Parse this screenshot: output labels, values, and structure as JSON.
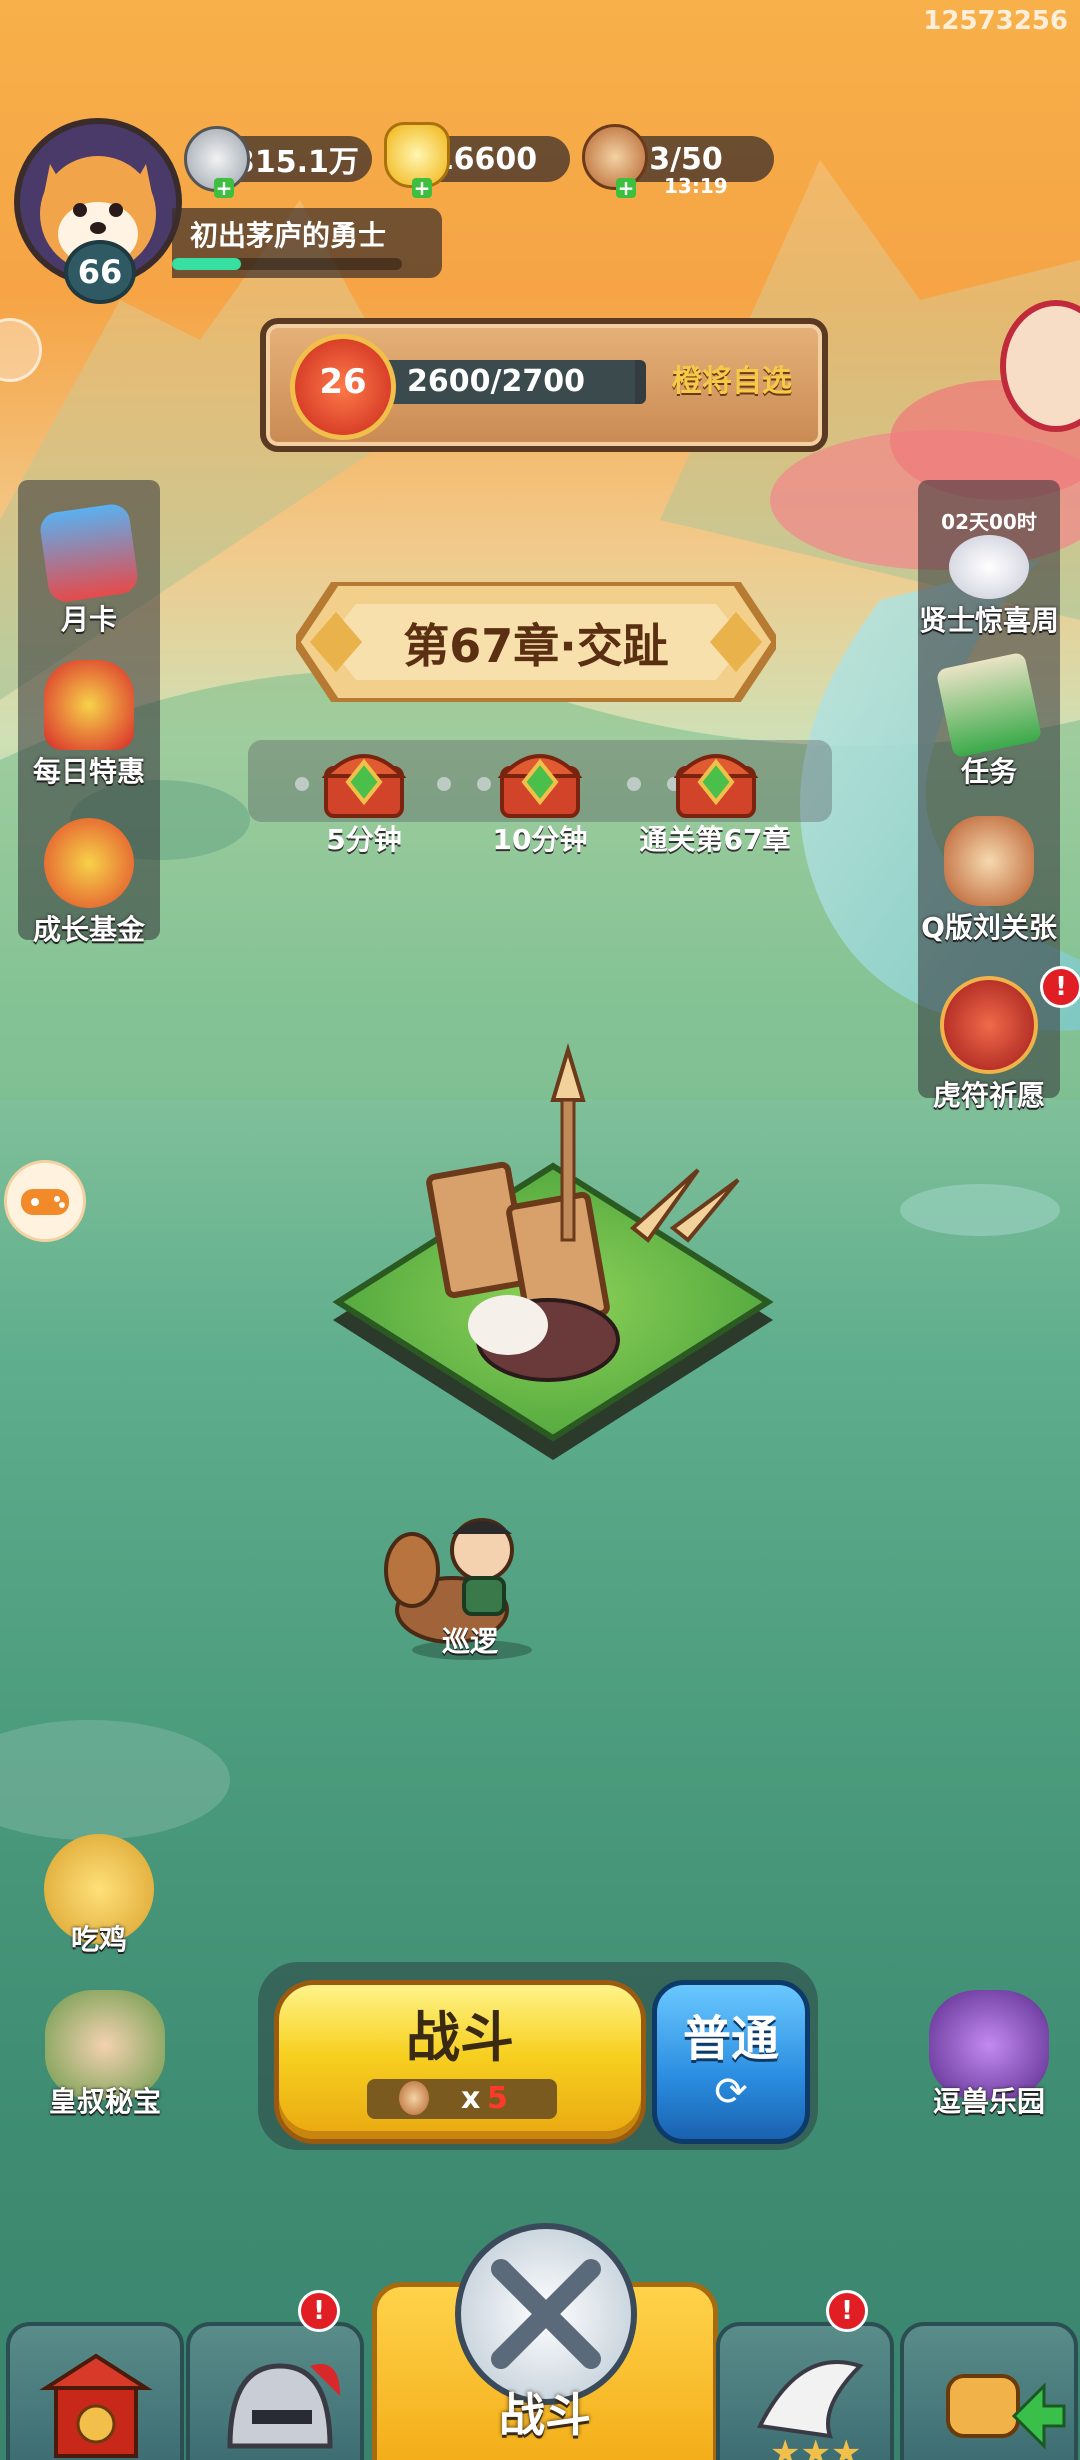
{
  "app_id": "12573256",
  "player": {
    "level": "66",
    "title": "初出茅庐的勇士",
    "exp_fraction": 0.3
  },
  "resources": {
    "silver": "2315.1万",
    "gold": "16600",
    "stamina": "3/50",
    "stamina_timer": "13:19"
  },
  "rank_bar": {
    "level": "26",
    "progress_text": "2600/2700",
    "progress_fraction": 0.963,
    "action_label": "橙将自选"
  },
  "left_menu": [
    {
      "label": "月卡",
      "icon": "month-card-icon"
    },
    {
      "label": "每日特惠",
      "icon": "daily-deal-icon"
    },
    {
      "label": "成长基金",
      "icon": "growth-fund-icon"
    }
  ],
  "right_menu": [
    {
      "label": "贤士惊喜周",
      "timer": "02天00时",
      "icon": "sage-surprise-icon"
    },
    {
      "label": "任务",
      "icon": "quest-icon"
    },
    {
      "label": "Q版刘关张",
      "icon": "q-heroes-icon"
    },
    {
      "label": "虎符祈愿",
      "icon": "tiger-tally-icon",
      "alert": "!"
    }
  ],
  "chapter": {
    "title": "第67章·交趾"
  },
  "rewards": [
    {
      "label": "5分钟"
    },
    {
      "label": "10分钟"
    },
    {
      "label": "通关第67章"
    }
  ],
  "hero": {
    "status": "巡逻"
  },
  "bottom_left": [
    {
      "label": "吃鸡",
      "icon": "chicken-icon"
    },
    {
      "label": "皇叔秘宝",
      "icon": "uncle-treasure-icon"
    }
  ],
  "bottom_right": {
    "label": "逗兽乐园",
    "icon": "beast-park-icon"
  },
  "battle": {
    "label": "战斗",
    "cost_prefix": "x",
    "cost": "5"
  },
  "mode": {
    "label": "普通"
  },
  "tabs": [
    {
      "name": "city",
      "icon": "gate-icon"
    },
    {
      "name": "hero",
      "icon": "helmet-icon",
      "alert": "!"
    },
    {
      "name": "battle",
      "label": "战斗",
      "icon": "crossed-swords-icon"
    },
    {
      "name": "treasure",
      "icon": "wing-stars-icon",
      "alert": "!"
    },
    {
      "name": "upgrade",
      "icon": "fist-upgrade-icon"
    }
  ],
  "colors": {
    "accent_gold": "#f7c948",
    "panel_dark": "#3c2d28",
    "mode_blue": "#2a8de0",
    "alert_red": "#e01e24"
  }
}
